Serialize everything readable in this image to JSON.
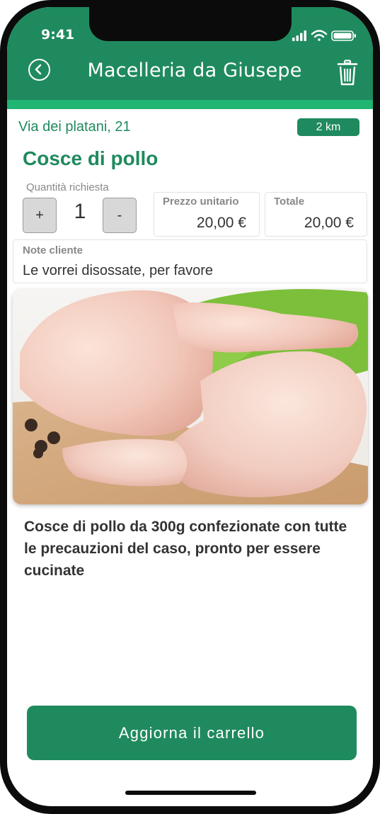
{
  "status_bar": {
    "time": "9:41"
  },
  "header": {
    "title": "Macelleria da Giusepe"
  },
  "shop": {
    "address": "Via dei platani, 21",
    "distance": "2 km"
  },
  "product": {
    "name": "Cosce di pollo",
    "quantity_label": "Quantità richiesta",
    "increment_label": "+",
    "decrement_label": "-",
    "quantity": "1",
    "unit_price_label": "Prezzo unitario",
    "unit_price": "20,00 €",
    "total_label": "Totale",
    "total": "20,00 €",
    "notes_label": "Note cliente",
    "notes": "Le vorrei disossate, per favore",
    "description": "Cosce di pollo da 300g confezionate con tutte le precauzioni del caso, pronto per essere cucinate"
  },
  "actions": {
    "update_cart": "Aggiorna il carrello"
  },
  "colors": {
    "primary": "#1f8a5e",
    "accent_line": "#21b573"
  },
  "icons": [
    "back-icon",
    "trash-icon",
    "signal-icon",
    "wifi-icon",
    "battery-icon"
  ]
}
